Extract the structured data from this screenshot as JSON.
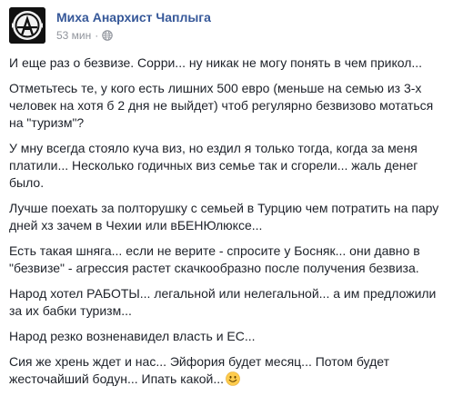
{
  "post": {
    "author": "Миха Анархист Чаплыга",
    "timestamp": "53 мин",
    "separator": "·",
    "privacy_icon": "globe-icon",
    "avatar_icon": "anarchist-emblem-icon",
    "paragraphs": [
      "И еще раз о безвизе. Сорри... ну никак не могу понять в чем прикол...",
      "Отметьтесь те, у кого есть лишних 500 евро (меньше на семью из 3-х человек на хотя б 2 дня не выйдет) чтоб регулярно безвизово мотаться на \"туризм\"?",
      "У мну всегда стояло куча виз, но ездил я только тогда, когда за меня платили... Несколько годичных виз семье так и сгорели... жаль денег было.",
      "Лучше поехать за полторушку с семьей в Турцию чем потратить на пару дней хз зачем в Чехии или вБЕНЮлюксе...",
      "Есть такая шняга... если не верите - спросите у Босняк... они давно в \"безвизе\" - агрессия растет скачкообразно после получения безвиза.",
      "Народ хотел РАБОТЫ... легальной или нелегальной... а им предложили за их бабки туризм...",
      "Народ резко возненавидел власть и ЕС...",
      "Сия же хрень ждет и нас... Эйфория будет месяц... Потом будет жесточайший бодун... Ипать какой..."
    ],
    "final_emoji": "smile-emoji-icon"
  },
  "colors": {
    "author_link": "#365899",
    "meta_text": "#90949c",
    "body_text": "#1d2129",
    "emoji_face": "#ffcc4d"
  }
}
